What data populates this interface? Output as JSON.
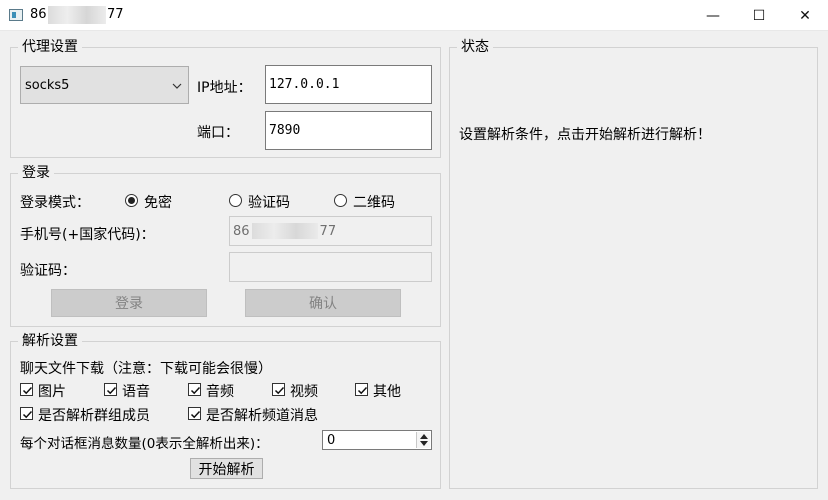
{
  "window": {
    "title_prefix": "86",
    "title_suffix": "77",
    "min_glyph": "—",
    "max_glyph": "☐",
    "close_glyph": "✕"
  },
  "proxy": {
    "group_title": "代理设置",
    "protocol": "socks5",
    "ip_label": "IP地址：",
    "ip_value": "127.0.0.1",
    "port_label": "端口：",
    "port_value": "7890"
  },
  "login": {
    "group_title": "登录",
    "mode_label": "登录模式：",
    "modes": [
      {
        "label": "免密",
        "selected": true
      },
      {
        "label": "验证码",
        "selected": false
      },
      {
        "label": "二维码",
        "selected": false
      }
    ],
    "phone_label": "手机号(+国家代码)：",
    "phone_prefix": "86",
    "phone_suffix": "77",
    "code_label": "验证码：",
    "code_value": "",
    "login_button": "登录",
    "confirm_button": "确认"
  },
  "parse": {
    "group_title": "解析设置",
    "download_label": "聊天文件下载（注意：下载可能会很慢）",
    "file_types": [
      {
        "label": "图片",
        "checked": true
      },
      {
        "label": "语音",
        "checked": true
      },
      {
        "label": "音频",
        "checked": true
      },
      {
        "label": "视频",
        "checked": true
      },
      {
        "label": "其他",
        "checked": true
      }
    ],
    "options": [
      {
        "label": "是否解析群组成员",
        "checked": true
      },
      {
        "label": "是否解析频道消息",
        "checked": true
      }
    ],
    "count_label": "每个对话框消息数量(0表示全解析出来)：",
    "count_value": "0",
    "start_button": "开始解析"
  },
  "status": {
    "group_title": "状态",
    "message": "设置解析条件，点击开始解析进行解析！"
  }
}
